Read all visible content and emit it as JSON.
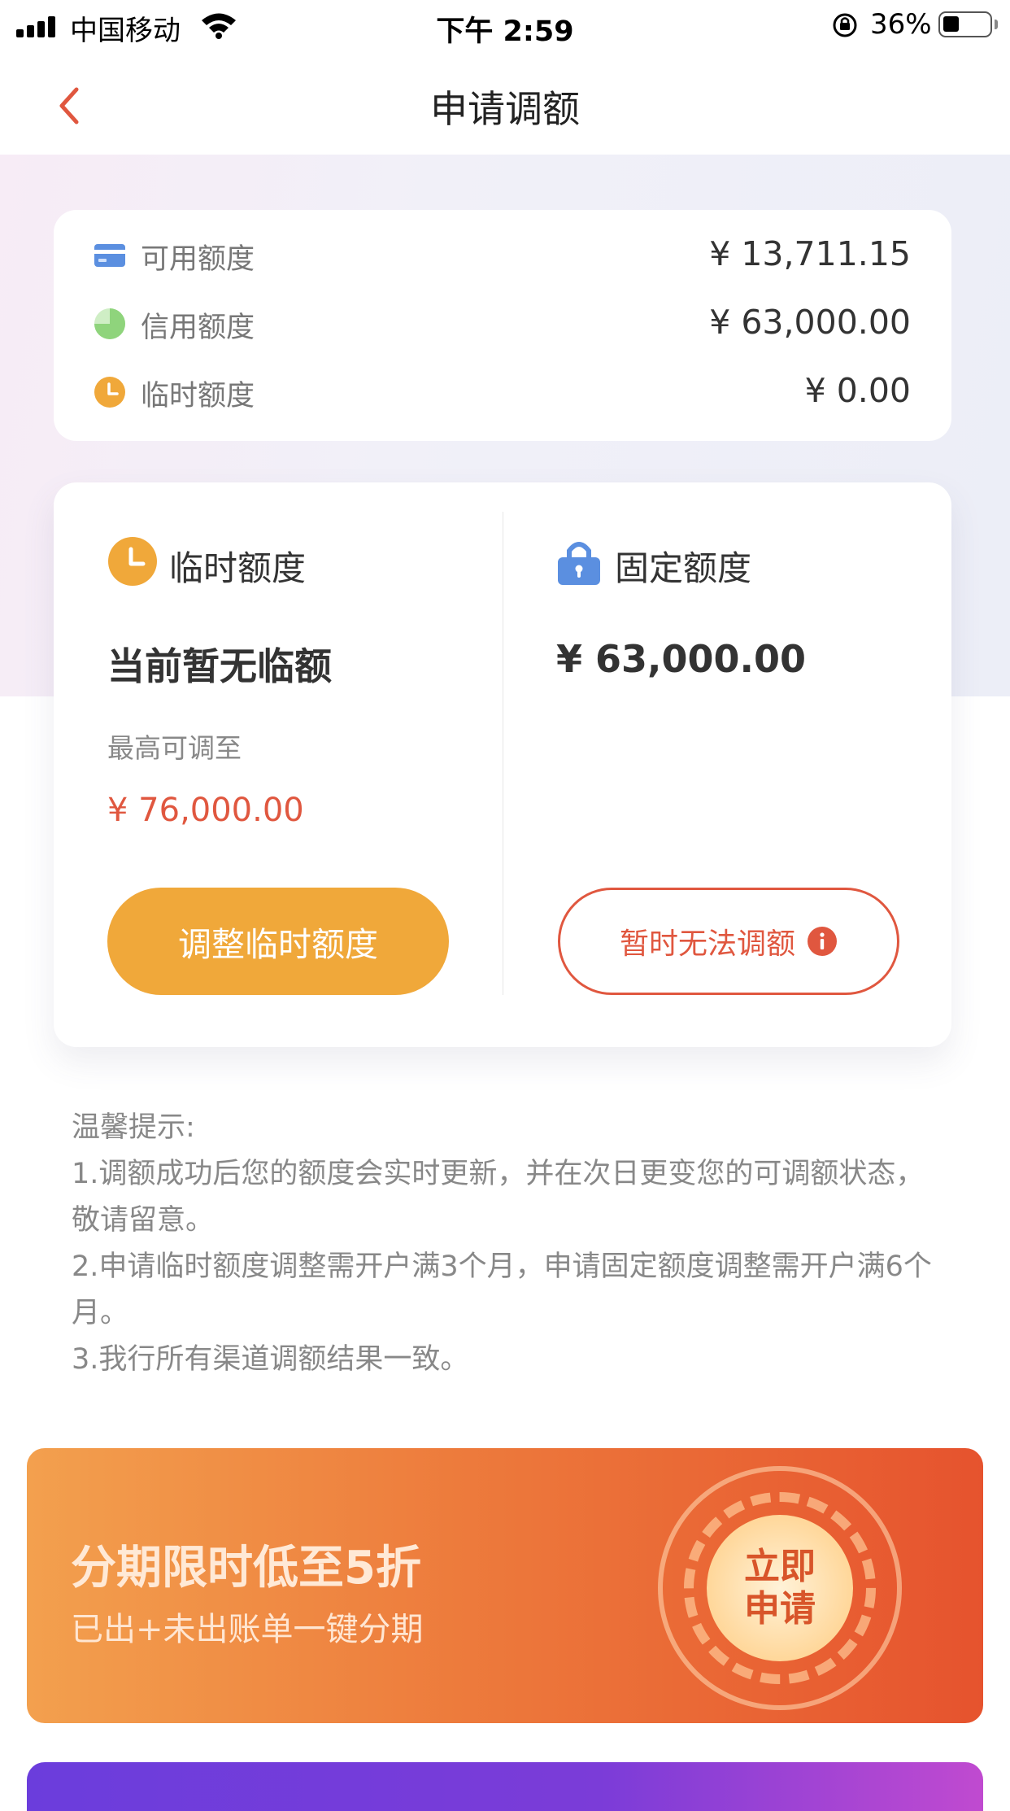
{
  "status_bar": {
    "carrier": "中国移动",
    "time": "下午 2:59",
    "battery_pct": "36%",
    "battery_level": 0.36
  },
  "nav": {
    "title": "申请调额"
  },
  "summary": {
    "rows": [
      {
        "label": "可用额度",
        "value": "¥ 13,711.15",
        "icon": "card-icon",
        "color": "#5b8fe0"
      },
      {
        "label": "信用额度",
        "value": "¥ 63,000.00",
        "icon": "pie-icon",
        "color": "#8fd47c"
      },
      {
        "label": "临时额度",
        "value": "¥ 0.00",
        "icon": "clock-icon",
        "color": "#f0a83a"
      }
    ]
  },
  "temp_quota": {
    "heading": "临时额度",
    "status": "当前暂无临额",
    "max_label": "最高可调至",
    "max_value": "¥ 76,000.00",
    "button": "调整临时额度",
    "icon": "clock-icon"
  },
  "fixed_quota": {
    "heading": "固定额度",
    "amount": "¥ 63,000.00",
    "button": "暂时无法调额",
    "icon": "lock-icon",
    "info_icon": "info-icon"
  },
  "tips": {
    "title": "温馨提示:",
    "items": [
      "1.调额成功后您的额度会实时更新，并在次日更变您的可调额状态，敬请留意。",
      "2.申请临时额度调整需开户满3个月，申请固定额度调整需开户满6个月。",
      "3.我行所有渠道调额结果一致。"
    ]
  },
  "promo": {
    "title": "分期限时低至5折",
    "subtitle": "已出+未出账单一键分期",
    "cta_line1": "立即",
    "cta_line2": "申请"
  },
  "colors": {
    "accent_orange": "#f0a83a",
    "accent_red": "#e0573f"
  }
}
